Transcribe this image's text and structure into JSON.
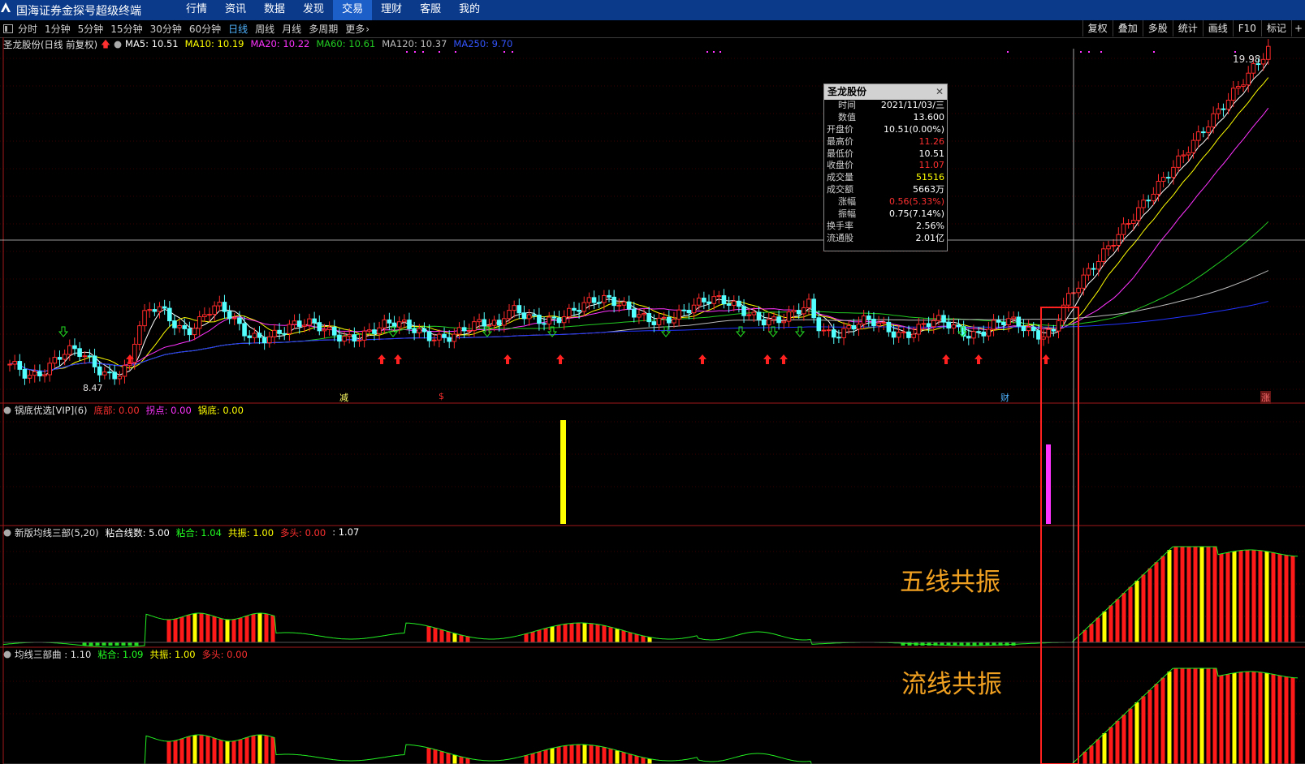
{
  "app": {
    "title": "国海证券金探号超级终端",
    "menu": [
      "行情",
      "资讯",
      "数据",
      "发现",
      "交易",
      "理财",
      "客服",
      "我的"
    ],
    "active_menu": 4
  },
  "toolbar": {
    "periods": [
      "分时",
      "1分钟",
      "5分钟",
      "15分钟",
      "30分钟",
      "60分钟",
      "日线",
      "周线",
      "月线",
      "多周期",
      "更多"
    ],
    "active_period": 6,
    "tools": [
      "复权",
      "叠加",
      "多股",
      "统计",
      "画线",
      "F10",
      "标记"
    ]
  },
  "colors": {
    "up": "#ff2a2a",
    "down": "#54ffff",
    "ma5": "#ffffff",
    "ma10": "#ffff00",
    "ma20": "#ff33ff",
    "ma60": "#22cc22",
    "ma120": "#bbbbbb",
    "ma250": "#2233ff"
  },
  "main_panel": {
    "stock_label": "圣龙股份(日线 前复权)",
    "ma_legend": [
      {
        "label": "MA5: 10.51",
        "color": "#ffffff"
      },
      {
        "label": "MA10: 10.19",
        "color": "#ffff00"
      },
      {
        "label": "MA20: 10.22",
        "color": "#ff33ff"
      },
      {
        "label": "MA60: 10.61",
        "color": "#22cc22"
      },
      {
        "label": "MA120: 10.37",
        "color": "#bbbbbb"
      },
      {
        "label": "MA250: 9.70",
        "color": "#2255ff"
      }
    ],
    "high_label": "19.98",
    "low_label": "8.47",
    "event_markers": [
      "减",
      "$",
      "财",
      "涨"
    ]
  },
  "popup": {
    "title": "圣龙股份",
    "rows": [
      {
        "k": "时间",
        "v": "2021/11/03/三",
        "c": "#ffffff"
      },
      {
        "k": "数值",
        "v": "13.600",
        "c": "#ffffff"
      },
      {
        "k": "开盘价",
        "v": "10.51(0.00%)",
        "c": "#ffffff"
      },
      {
        "k": "最高价",
        "v": "11.26",
        "c": "#ff3030"
      },
      {
        "k": "最低价",
        "v": "10.51",
        "c": "#ffffff"
      },
      {
        "k": "收盘价",
        "v": "11.07",
        "c": "#ff3030"
      },
      {
        "k": "成交量",
        "v": "51516",
        "c": "#ffff00"
      },
      {
        "k": "成交额",
        "v": "5663万",
        "c": "#ffffff"
      },
      {
        "k": "涨幅",
        "v": "0.56(5.33%)",
        "c": "#ff3030"
      },
      {
        "k": "振幅",
        "v": "0.75(7.14%)",
        "c": "#ffffff"
      },
      {
        "k": "换手率",
        "v": "2.56%",
        "c": "#ffffff"
      },
      {
        "k": "流通股",
        "v": "2.01亿",
        "c": "#ffffff"
      }
    ]
  },
  "panel2": {
    "name": "锅底优选[VIP](6)",
    "items": [
      {
        "label": "底部: 0.00",
        "color": "#ff3030"
      },
      {
        "label": "拐点: 0.00",
        "color": "#ff33ff"
      },
      {
        "label": "锅底: 0.00",
        "color": "#ffff00"
      }
    ]
  },
  "panel3": {
    "name": "新版均线三部(5,20)",
    "items": [
      {
        "label": "粘合线数: 5.00",
        "color": "#ffffff"
      },
      {
        "label": "粘合: 1.04",
        "color": "#22ff22"
      },
      {
        "label": "共振: 1.00",
        "color": "#ffff00"
      },
      {
        "label": "多头: 0.00",
        "color": "#ff3030"
      },
      {
        "label": ": 1.07",
        "color": "#ffffff"
      }
    ],
    "annotation": "五线共振"
  },
  "panel4": {
    "name": "均线三部曲 : 1.10",
    "items": [
      {
        "label": "粘合: 1.09",
        "color": "#22ff22"
      },
      {
        "label": "共振: 1.00",
        "color": "#ffff00"
      },
      {
        "label": "多头: 0.00",
        "color": "#ff3030"
      }
    ],
    "annotation": "流线共振"
  }
}
